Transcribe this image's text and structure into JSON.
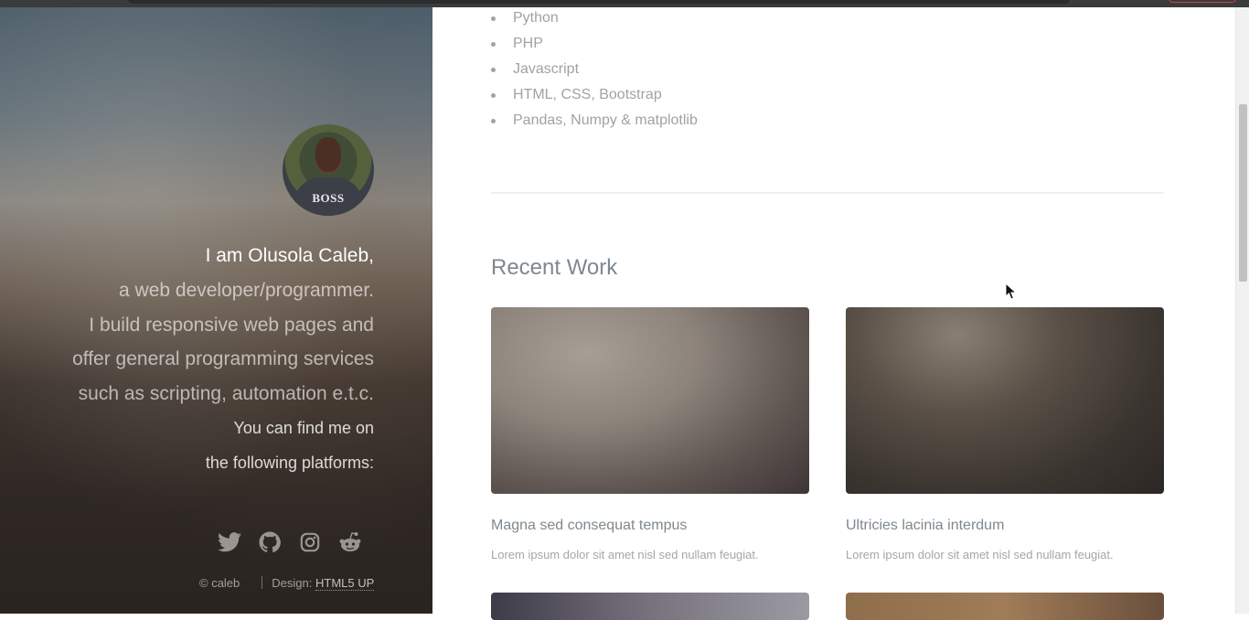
{
  "sidebar": {
    "avatar_shirt_text": "BOSS",
    "intro_name": "I am Olusola Caleb,",
    "intro_lines": [
      "a web developer/programmer.",
      "I build responsive web pages and",
      "offer general programming services",
      "such as scripting, automation e.t.c."
    ],
    "find_lines": [
      "You can find me on",
      "the following platforms:"
    ],
    "social": [
      "twitter-icon",
      "github-icon",
      "instagram-icon",
      "reddit-icon"
    ],
    "footer": {
      "copyright": "© caleb",
      "design_label": "Design:",
      "design_link": "HTML5 UP"
    }
  },
  "main": {
    "skills": [
      "Python",
      "PHP",
      "Javascript",
      "HTML, CSS, Bootstrap",
      "Pandas, Numpy & matplotlib"
    ],
    "recent_work_title": "Recent Work",
    "works": [
      {
        "title": "Magna sed consequat tempus",
        "description": "Lorem ipsum dolor sit amet nisl sed nullam feugiat."
      },
      {
        "title": "Ultricies lacinia interdum",
        "description": "Lorem ipsum dolor sit amet nisl sed nullam feugiat."
      }
    ]
  },
  "colors": {
    "accent_text": "#7f888f",
    "muted_text": "#a2a2a2",
    "sidebar_dark": "#2a2421"
  }
}
